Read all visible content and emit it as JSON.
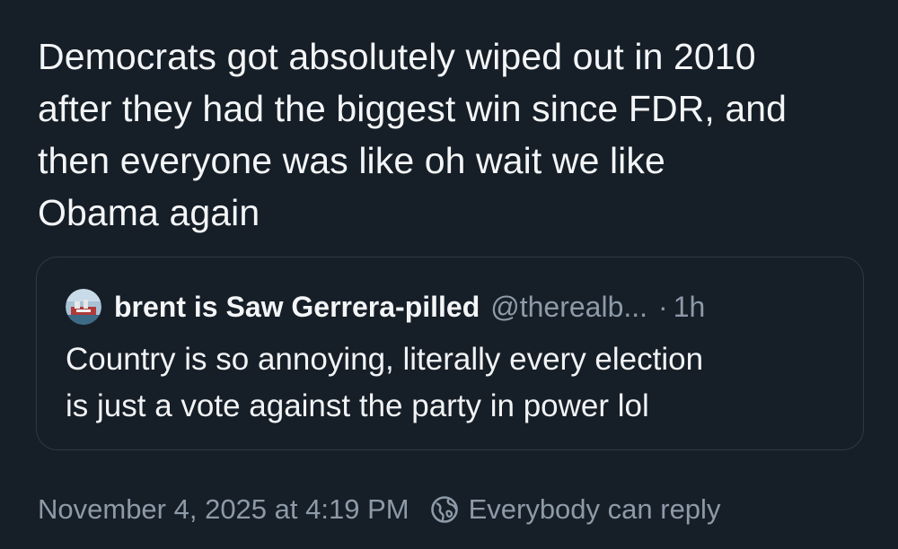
{
  "post": {
    "text": "Democrats got absolutely wiped out in 2010\nafter they had the biggest win since FDR, and\nthen everyone was like oh wait we like\nObama again"
  },
  "quoted_post": {
    "author_name": "brent is Saw Gerrera-pilled",
    "author_handle": "@therealb...",
    "separator": "·",
    "time_ago": "1h",
    "text": "Country is so annoying, literally every election\nis just a vote against the party in power lol"
  },
  "footer": {
    "timestamp": "November 4, 2025 at 4:19 PM",
    "reply_setting": "Everybody can reply"
  },
  "icons": {
    "avatar": "avatar-image",
    "reply_setting": "globe-icon"
  },
  "colors": {
    "background": "#161e27",
    "text": "#f3f5f7",
    "muted": "#8d9aa8",
    "border": "#2e3845"
  }
}
